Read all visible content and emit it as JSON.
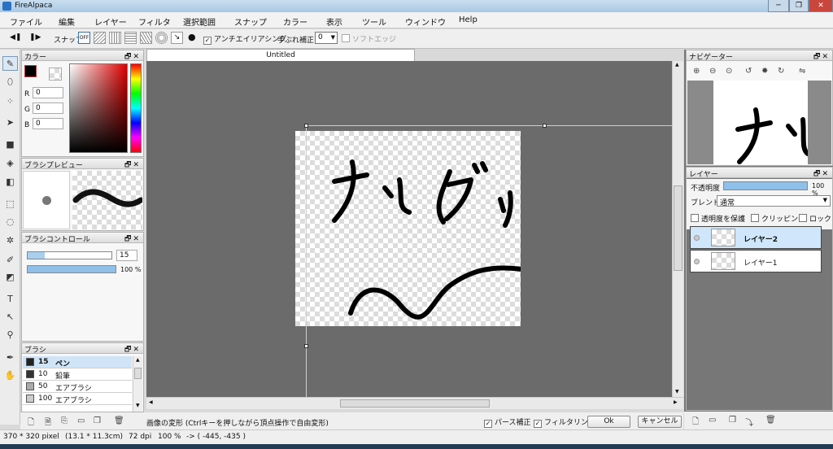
{
  "window": {
    "title": "FireAlpaca",
    "minimize_glyph": "─",
    "maximize_glyph": "❐",
    "close_glyph": "✕"
  },
  "menu": [
    "ファイル",
    "編集",
    "レイヤー",
    "フィルタ",
    "選択範囲",
    "スナップ",
    "カラー",
    "表示",
    "ツール",
    "ウィンドウ",
    "Help"
  ],
  "toolbar": {
    "snap_label": "スナップ",
    "snap_off": "OFF",
    "antialias_label": "アンチエイリアシング",
    "antialias_checked": true,
    "stabilizer_label": "手ぶれ補正",
    "stabilizer_value": "0",
    "soft_edge_label": "ソフトエッジ",
    "soft_edge_checked": false
  },
  "color_panel": {
    "title": "カラー",
    "r_label": "R",
    "r_value": "0",
    "g_label": "G",
    "g_value": "0",
    "b_label": "B",
    "b_value": "0",
    "primary_color": "#000000"
  },
  "brush_preview": {
    "title": "ブラシプレビュー"
  },
  "brush_control": {
    "title": "ブラシコントロール",
    "size": "15",
    "size_fraction": 0.2,
    "opacity": "100 %",
    "opacity_fraction": 1.0
  },
  "brush_panel": {
    "title": "ブラシ",
    "items": [
      {
        "size": "15",
        "name": "ペン",
        "selected": true,
        "swatch": "#222222"
      },
      {
        "size": "10",
        "name": "鉛筆",
        "selected": false,
        "swatch": "#333333"
      },
      {
        "size": "50",
        "name": "エアブラシ",
        "selected": false,
        "swatch": "#aaaaaa"
      },
      {
        "size": "100",
        "name": "エアブラシ",
        "selected": false,
        "swatch": "#cccccc"
      }
    ]
  },
  "document": {
    "tab_title": "Untitled"
  },
  "transform_bar": {
    "message": "画像の変形 (Ctrlキーを押しながら頂点操作で自由変形)",
    "perspective_label": "パース補正",
    "perspective_checked": true,
    "filtering_label": "フィルタリング",
    "filtering_checked": true,
    "ok_label": "Ok",
    "cancel_label": "キャンセル"
  },
  "status": {
    "image_size": "370 * 320 pixel",
    "physical_size": "(13.1 * 11.3cm)",
    "dpi": "72 dpi",
    "zoom": "100 %",
    "cursor": "-> ( -445, -435 )"
  },
  "navigator": {
    "title": "ナビゲーター"
  },
  "layer_panel": {
    "title": "レイヤー",
    "opacity_label": "不透明度",
    "opacity_value": "100 %",
    "opacity_fraction": 1.0,
    "blend_label": "ブレンド",
    "blend_value": "通常",
    "protect_alpha_label": "透明度を保護",
    "clipping_label": "クリッピング",
    "lock_label": "ロック",
    "layers": [
      {
        "name": "レイヤー2",
        "selected": true
      },
      {
        "name": "レイヤー1",
        "selected": false
      }
    ]
  }
}
